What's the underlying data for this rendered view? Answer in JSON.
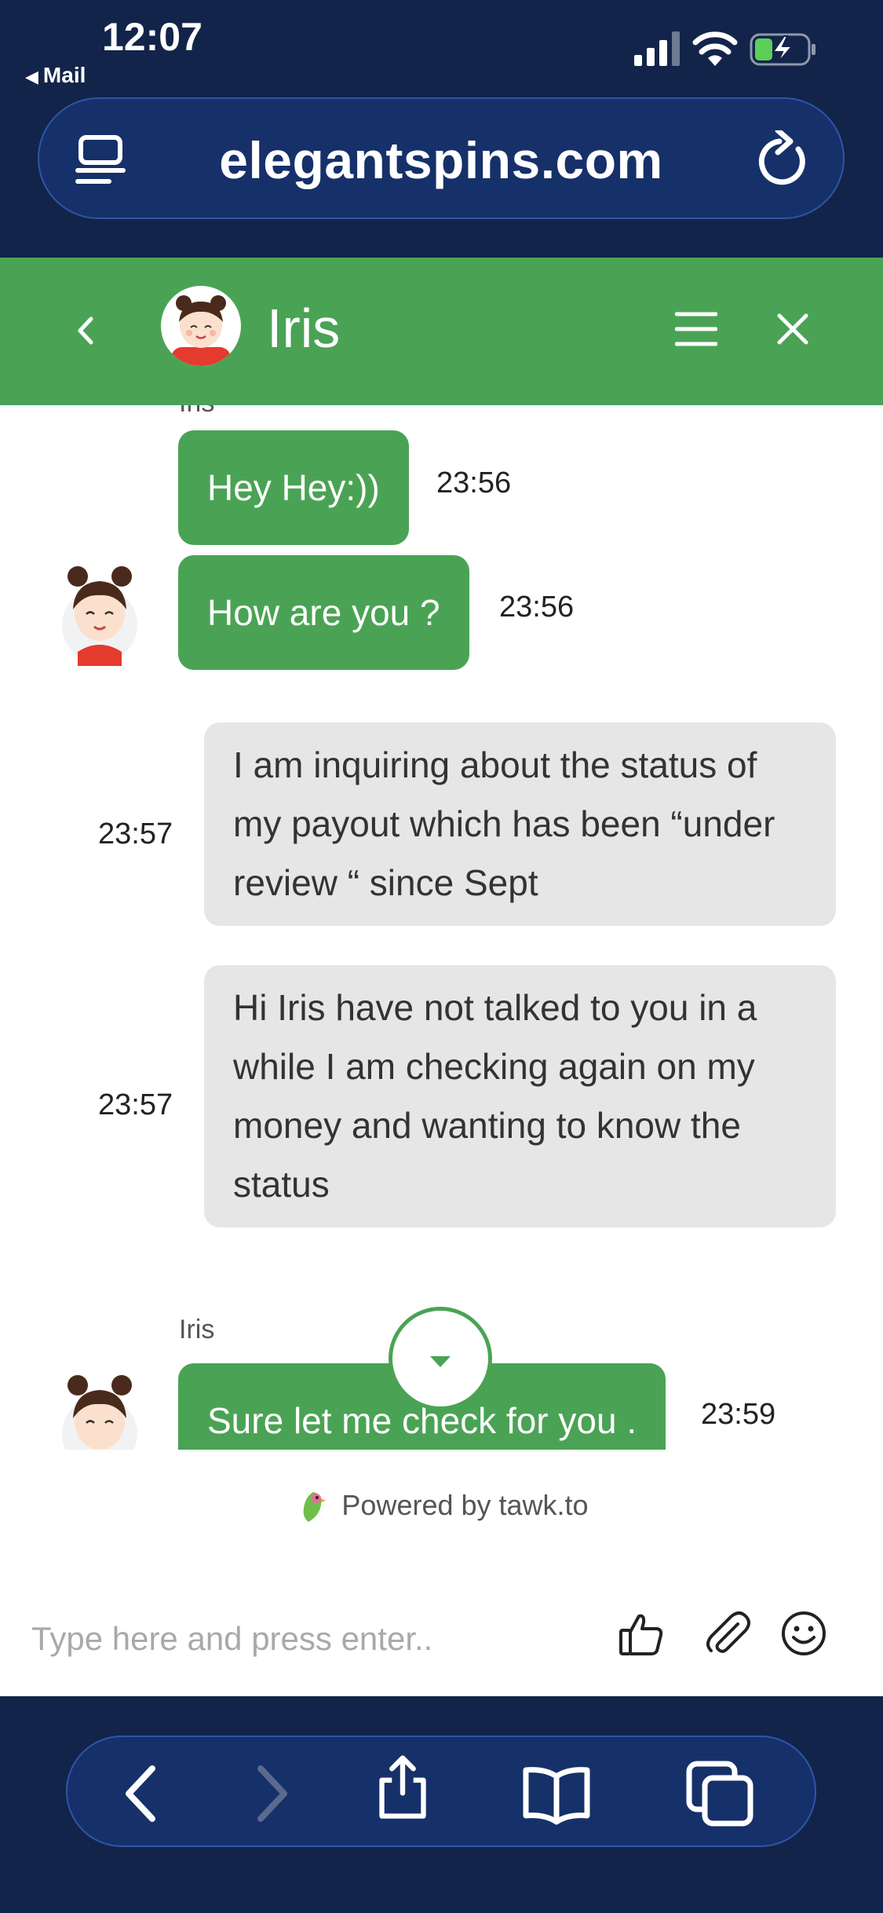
{
  "status_bar": {
    "time": "12:07",
    "back_app": "Mail",
    "icons": [
      "cellular-signal-icon",
      "wifi-icon",
      "battery-charging-icon"
    ]
  },
  "address_bar": {
    "domain": "elegantspins.com",
    "left_icon": "reader-view-icon",
    "right_icon": "reload-icon"
  },
  "chat_header": {
    "agent_name": "Iris",
    "bg_color": "#4aa354",
    "icons": [
      "back-chevron-icon",
      "agent-avatar",
      "menu-icon",
      "close-icon"
    ]
  },
  "messages": [
    {
      "sender": "agent",
      "label": "Iris",
      "text": "Hey Hey:))",
      "time": "23:56"
    },
    {
      "sender": "agent",
      "text": "How are you ?",
      "time": "23:56"
    },
    {
      "sender": "visitor",
      "text": "I am inquiring about the status of my payout which has been “under review “ since Sept",
      "time": "23:57"
    },
    {
      "sender": "visitor",
      "text": "Hi Iris have not talked to you in a while I am checking again on my money and wanting to know the status",
      "time": "23:57"
    },
    {
      "sender": "agent",
      "label": "Iris",
      "text": "Sure let me check for you .",
      "time": "23:59"
    }
  ],
  "composer": {
    "powered_by": "Powered by tawk.to",
    "placeholder": "Type here and press enter..",
    "value": "",
    "icons": [
      "thumbs-up-icon",
      "attachment-icon",
      "emoji-icon"
    ]
  },
  "bottom_toolbar": {
    "buttons": [
      "back-icon",
      "forward-icon",
      "share-icon",
      "bookmarks-icon",
      "tabs-icon"
    ]
  },
  "colors": {
    "browser_chrome": "#13244a",
    "chat_green": "#4aa354",
    "visitor_bubble": "#e6e6e6"
  }
}
